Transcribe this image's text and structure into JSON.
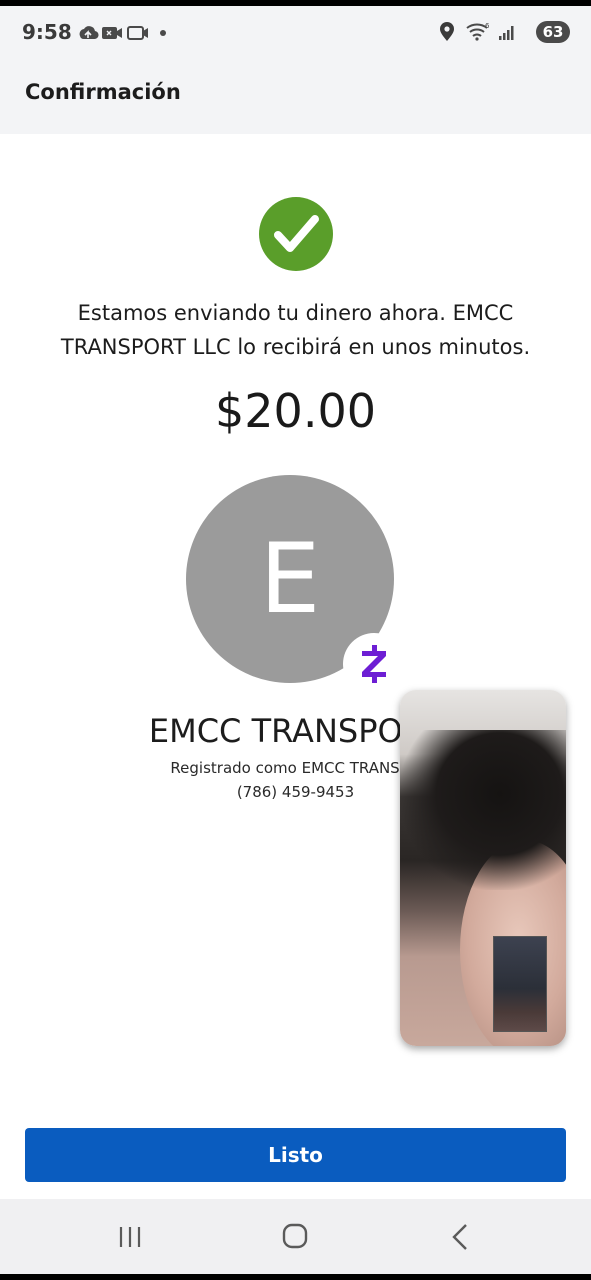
{
  "status_bar": {
    "time": "9:58",
    "battery": "63",
    "icons_left": [
      "cloud-upload-icon",
      "video-call-icon",
      "camera-icon",
      "dot-icon"
    ],
    "icons_right": [
      "location-icon",
      "wifi-icon",
      "signal-icon"
    ]
  },
  "header": {
    "title": "Confirmación"
  },
  "confirmation": {
    "success_icon": "check-circle-icon",
    "success_color": "#5a9e2a",
    "message": "Estamos enviando tu dinero ahora. EMCC TRANSPORT LLC lo recibirá en unos minutos.",
    "amount": "$20.00"
  },
  "recipient": {
    "avatar_initial": "E",
    "avatar_color": "#9b9b9b",
    "badge_icon": "zelle-icon",
    "badge_color": "#6d1ed4",
    "name": "EMCC TRANSPORT",
    "registered_as": "Registrado como EMCC TRANSPO",
    "phone": "(786) 459-9453"
  },
  "actions": {
    "done_label": "Listo",
    "done_color": "#0a5cbf"
  },
  "nav_bar": {
    "icons": [
      "recent-apps-icon",
      "home-icon",
      "back-icon"
    ]
  }
}
